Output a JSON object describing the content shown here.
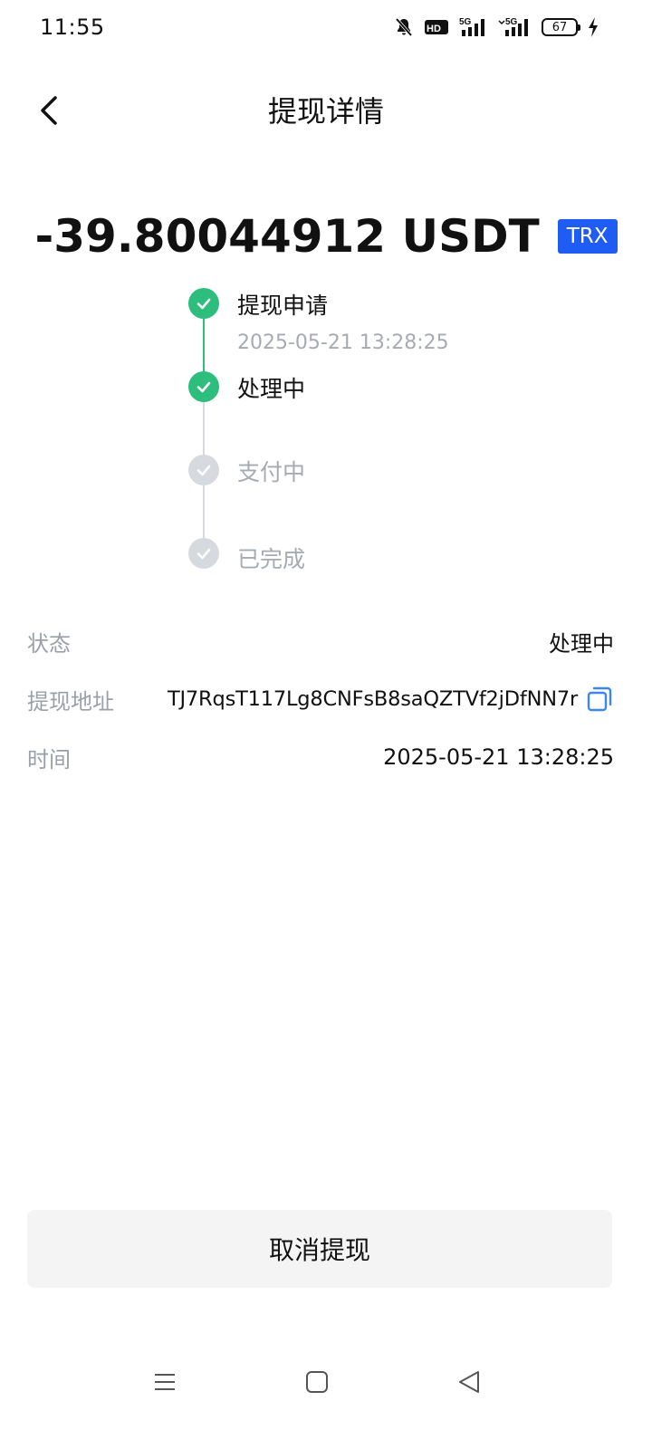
{
  "status_bar": {
    "time": "11:55",
    "battery": "67",
    "icons": [
      "bell-muted-icon",
      "hd-icon",
      "signal-5g-icon",
      "signal-5g-icon",
      "battery-icon",
      "charging-icon"
    ],
    "network_label": "5G",
    "hd_label": "HD"
  },
  "header": {
    "title": "提现详情",
    "back_icon": "chevron-left-icon"
  },
  "amount": {
    "value": "-39.80044912 USDT",
    "chain": "TRX",
    "chain_color": "#1e5cf3"
  },
  "timeline": {
    "done_color": "#2dbd7c",
    "pending_color": "#d6d9de",
    "steps": [
      {
        "label": "提现申请",
        "time": "2025-05-21 13:28:25",
        "status": "done"
      },
      {
        "label": "处理中",
        "time": "",
        "status": "done"
      },
      {
        "label": "支付中",
        "time": "",
        "status": "pending"
      },
      {
        "label": "已完成",
        "time": "",
        "status": "pending"
      }
    ]
  },
  "details": {
    "status_label": "状态",
    "status_value": "处理中",
    "address_label": "提现地址",
    "address_value": "TJ7RqsT117Lg8CNFsB8saQZTVf2jDfNN7r",
    "time_label": "时间",
    "time_value": "2025-05-21 13:28:25"
  },
  "actions": {
    "cancel_label": "取消提现"
  },
  "nav_bar": {
    "icons": [
      "menu-icon",
      "home-icon",
      "back-icon"
    ]
  }
}
